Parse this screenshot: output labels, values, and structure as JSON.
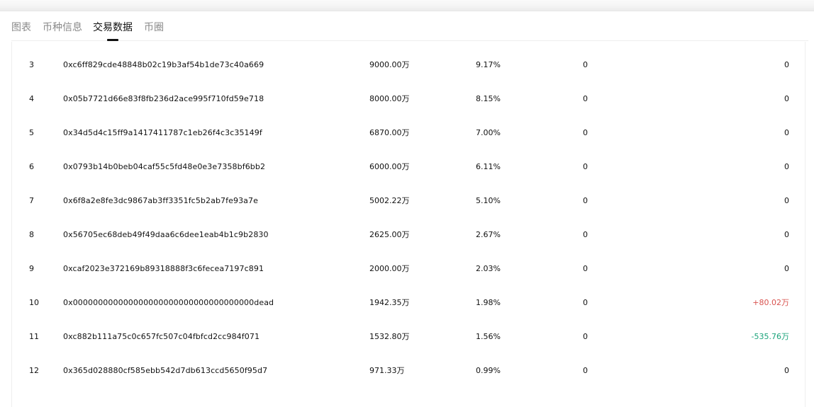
{
  "tabs": [
    {
      "label": "图表",
      "active": false
    },
    {
      "label": "币种信息",
      "active": false
    },
    {
      "label": "交易数据",
      "active": true
    },
    {
      "label": "币圈",
      "active": false
    }
  ],
  "holders": [
    {
      "rank": "3",
      "address": "0xc6ff829cde48848b02c19b3af54b1de73c40a669",
      "quantity": "9000.00万",
      "percent": "9.17%",
      "change": "0",
      "change2": "0",
      "change2_trend": "none"
    },
    {
      "rank": "4",
      "address": "0x05b7721d66e83f8fb236d2ace995f710fd59e718",
      "quantity": "8000.00万",
      "percent": "8.15%",
      "change": "0",
      "change2": "0",
      "change2_trend": "none"
    },
    {
      "rank": "5",
      "address": "0x34d5d4c15ff9a1417411787c1eb26f4c3c35149f",
      "quantity": "6870.00万",
      "percent": "7.00%",
      "change": "0",
      "change2": "0",
      "change2_trend": "none"
    },
    {
      "rank": "6",
      "address": "0x0793b14b0beb04caf55c5fd48e0e3e7358bf6bb2",
      "quantity": "6000.00万",
      "percent": "6.11%",
      "change": "0",
      "change2": "0",
      "change2_trend": "none"
    },
    {
      "rank": "7",
      "address": "0x6f8a2e8fe3dc9867ab3ff3351fc5b2ab7fe93a7e",
      "quantity": "5002.22万",
      "percent": "5.10%",
      "change": "0",
      "change2": "0",
      "change2_trend": "none"
    },
    {
      "rank": "8",
      "address": "0x56705ec68deb49f49daa6c6dee1eab4b1c9b2830",
      "quantity": "2625.00万",
      "percent": "2.67%",
      "change": "0",
      "change2": "0",
      "change2_trend": "none"
    },
    {
      "rank": "9",
      "address": "0xcaf2023e372169b89318888f3c6fecea7197c891",
      "quantity": "2000.00万",
      "percent": "2.03%",
      "change": "0",
      "change2": "0",
      "change2_trend": "none"
    },
    {
      "rank": "10",
      "address": "0x000000000000000000000000000000000000dead",
      "quantity": "1942.35万",
      "percent": "1.98%",
      "change": "0",
      "change2": "+80.02万",
      "change2_trend": "up"
    },
    {
      "rank": "11",
      "address": "0xc882b111a75c0c657fc507c04fbfcd2cc984f071",
      "quantity": "1532.80万",
      "percent": "1.56%",
      "change": "0",
      "change2": "-535.76万",
      "change2_trend": "down"
    },
    {
      "rank": "12",
      "address": "0x365d028880cf585ebb542d7db613ccd5650f95d7",
      "quantity": "971.33万",
      "percent": "0.99%",
      "change": "0",
      "change2": "0",
      "change2_trend": "none"
    }
  ],
  "colors": {
    "up": "#d9534f",
    "down": "#1aa37a",
    "tab_active": "#111111",
    "tab_inactive": "#8a8a8a"
  }
}
